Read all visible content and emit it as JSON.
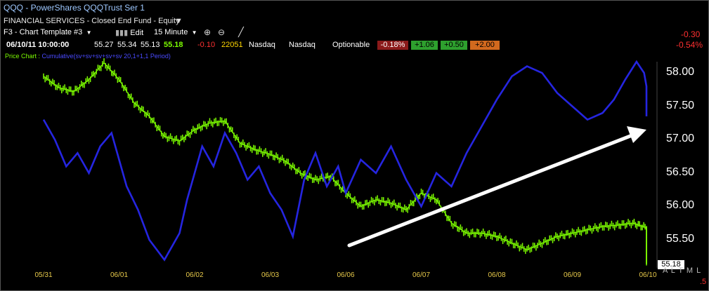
{
  "header": {
    "symbol_line": "QQQ  - PowerShares QQQTrust Ser 1",
    "sector_line": "FINANCIAL SERVICES - Closed End Fund - Equity",
    "template": "F3 - Chart Template #3",
    "edit": "Edit",
    "interval": "15 Minute"
  },
  "quote": {
    "datetime": "06/10/11 10:00:00",
    "open": "55.27",
    "high": "55.34",
    "low": "55.13",
    "last": "55.18",
    "change": "-0.10",
    "volume": "22051",
    "exchange1": "Nasdaq",
    "exchange2": "Nasdaq",
    "optionable": "Optionable",
    "pct_badge": "-0.18%",
    "badge2": "+1.06",
    "badge3": "+0.50",
    "badge4": "+2.00",
    "right_change": "-0.30",
    "right_pct": "-0.54%"
  },
  "colors": {
    "price_green": "#7cfc00",
    "indicator_blue": "#2525e0",
    "badge_red": "#8b1a1a",
    "badge_green": "#1e8f1e",
    "badge_orange": "#d2691e",
    "red_text": "#ff3030",
    "arrow": "#ffffff"
  },
  "legend": {
    "price_chart": "Price Chart :",
    "indicator": "Cumulative(sv+sv+sv+sv+sv 20,1+1,1 Period)"
  },
  "last_price_tag": "55.18",
  "corner_letters": "A  L  T  M  L",
  "corner_digit": ".5",
  "chart_data": {
    "type": "line",
    "y_axis_ticks": [
      "58.00",
      "57.50",
      "57.00",
      "56.50",
      "56.00",
      "55.50"
    ],
    "x_axis_ticks": [
      "05/31",
      "06/01",
      "06/02",
      "06/03",
      "06/06",
      "06/07",
      "06/08",
      "06/09",
      "06/10"
    ],
    "ylim": [
      55.2,
      58.3
    ],
    "series": [
      {
        "color": "#7cfc00",
        "x": [
          0,
          0.2,
          0.4,
          0.6,
          0.8,
          1.0,
          1.2,
          1.4,
          1.6,
          1.8,
          2.0,
          2.2,
          2.4,
          2.6,
          2.8,
          3.0,
          3.2,
          3.4,
          3.6,
          3.8,
          4.0,
          4.2,
          4.4,
          4.6,
          4.8,
          5.0,
          5.2,
          5.4,
          5.6,
          5.8,
          6.0,
          6.2,
          6.4,
          6.6,
          6.8,
          7.0,
          7.2,
          7.4,
          7.6,
          7.8,
          8.0,
          8.2,
          8.4,
          8.6,
          8.8,
          8.95
        ],
        "values": [
          57.95,
          57.78,
          57.72,
          57.9,
          58.15,
          57.9,
          57.55,
          57.35,
          57.05,
          56.98,
          57.15,
          57.25,
          57.28,
          56.95,
          56.85,
          56.78,
          56.68,
          56.5,
          56.4,
          56.45,
          56.2,
          56.0,
          56.1,
          56.05,
          55.95,
          56.2,
          56.1,
          55.75,
          55.6,
          55.6,
          55.55,
          55.45,
          55.35,
          55.45,
          55.55,
          55.6,
          55.65,
          55.7,
          55.72,
          55.75,
          55.68,
          55.45,
          55.3,
          55.25,
          55.22,
          55.18
        ]
      },
      {
        "color": "#2525e0",
        "x": [
          0,
          0.15,
          0.3,
          0.45,
          0.6,
          0.75,
          0.9,
          1.0,
          1.1,
          1.25,
          1.4,
          1.6,
          1.8,
          1.9,
          2.0,
          2.1,
          2.25,
          2.4,
          2.55,
          2.7,
          2.85,
          3.0,
          3.15,
          3.3,
          3.45,
          3.6,
          3.75,
          3.9,
          4.0,
          4.2,
          4.4,
          4.6,
          4.8,
          5.0,
          5.2,
          5.4,
          5.6,
          5.8,
          6.0,
          6.2,
          6.4,
          6.6,
          6.8,
          7.0,
          7.2,
          7.4,
          7.55,
          7.7,
          7.85,
          7.95,
          8.05,
          8.2
        ],
        "values": [
          57.3,
          57.0,
          56.6,
          56.8,
          56.5,
          56.9,
          57.1,
          56.7,
          56.3,
          55.95,
          55.5,
          55.2,
          55.6,
          56.1,
          56.5,
          56.9,
          56.6,
          57.1,
          56.8,
          56.4,
          56.6,
          56.2,
          55.95,
          55.55,
          56.4,
          56.8,
          56.3,
          56.6,
          56.2,
          56.7,
          56.5,
          56.9,
          56.4,
          56.0,
          56.5,
          56.3,
          56.8,
          57.2,
          57.6,
          57.95,
          58.1,
          58.0,
          57.7,
          57.5,
          57.3,
          57.4,
          57.6,
          57.9,
          58.2,
          58.0,
          57.8,
          57.35
        ]
      }
    ]
  }
}
